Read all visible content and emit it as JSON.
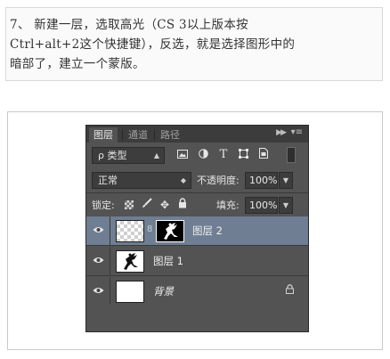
{
  "instruction": {
    "line1": "7、 新建一层，选取高光（CS 3以上版本按",
    "line2": "Ctrl+alt+2这个快捷键），反选，就是选择图形中的",
    "line3": "暗部了，建立一个蒙版。"
  },
  "panel": {
    "tabs": [
      {
        "label": "图层",
        "active": true
      },
      {
        "label": "通道",
        "active": false
      },
      {
        "label": "路径",
        "active": false
      }
    ],
    "filter": {
      "label": "ρ 类型",
      "icons": [
        "image-filter-icon",
        "adjustment-filter-icon",
        "type-filter-icon",
        "shape-filter-icon",
        "smart-object-filter-icon"
      ]
    },
    "blend_mode": "正常",
    "opacity_label": "不透明度:",
    "opacity_value": "100%",
    "lock_label": "锁定:",
    "fill_label": "填充:",
    "fill_value": "100%",
    "layers": [
      {
        "name": "图层 2",
        "selected": true,
        "italic": false,
        "locked": false
      },
      {
        "name": "图层 1",
        "selected": false,
        "italic": false,
        "locked": false
      },
      {
        "name": "背景",
        "selected": false,
        "italic": true,
        "locked": true
      }
    ]
  }
}
